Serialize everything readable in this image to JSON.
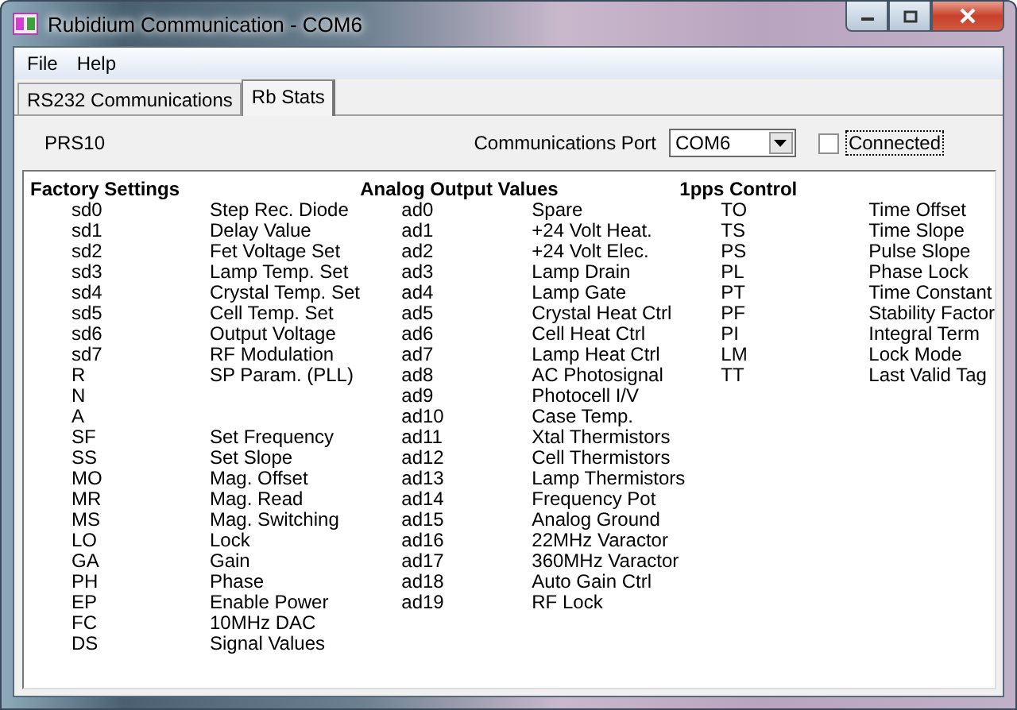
{
  "window": {
    "title": "Rubidium Communication - COM6"
  },
  "menu": [
    "File",
    "Help"
  ],
  "tabs": [
    {
      "label": "RS232 Communications",
      "selected": false
    },
    {
      "label": "Rb Stats",
      "selected": true
    }
  ],
  "device": "PRS10",
  "port": {
    "label": "Communications Port",
    "value": "COM6"
  },
  "connected": {
    "label": "Connected",
    "checked": false
  },
  "sections": [
    {
      "title": "Factory Settings",
      "rows": [
        {
          "code": "sd0",
          "name": "Step Rec. Diode"
        },
        {
          "code": "sd1",
          "name": "Delay Value"
        },
        {
          "code": "sd2",
          "name": "Fet Voltage Set"
        },
        {
          "code": "sd3",
          "name": "Lamp Temp. Set"
        },
        {
          "code": "sd4",
          "name": "Crystal Temp. Set"
        },
        {
          "code": "sd5",
          "name": "Cell Temp. Set"
        },
        {
          "code": "sd6",
          "name": "Output Voltage"
        },
        {
          "code": "sd7",
          "name": "RF Modulation"
        },
        {
          "code": "R",
          "name": "SP Param. (PLL)"
        },
        {
          "code": "N"
        },
        {
          "code": "A"
        },
        {
          "code": "SF",
          "name": "Set Frequency"
        },
        {
          "code": "SS",
          "name": "Set Slope"
        },
        {
          "code": "MO",
          "name": "Mag. Offset"
        },
        {
          "code": "MR",
          "name": "Mag. Read"
        },
        {
          "code": "MS",
          "name": "Mag. Switching"
        },
        {
          "code": "LO",
          "name": "Lock"
        },
        {
          "code": "GA",
          "name": "Gain"
        },
        {
          "code": "PH",
          "name": "Phase"
        },
        {
          "code": "EP",
          "name": "Enable Power"
        },
        {
          "code": "FC",
          "name": "10MHz DAC"
        },
        {
          "code": "DS",
          "name": "Signal Values"
        }
      ]
    },
    {
      "title": "Analog Output Values",
      "rows": [
        {
          "code": "ad0",
          "name": "Spare"
        },
        {
          "code": "ad1",
          "name": "+24 Volt Heat."
        },
        {
          "code": "ad2",
          "name": "+24 Volt Elec."
        },
        {
          "code": "ad3",
          "name": "Lamp Drain"
        },
        {
          "code": "ad4",
          "name": "Lamp Gate"
        },
        {
          "code": "ad5",
          "name": "Crystal Heat Ctrl"
        },
        {
          "code": "ad6",
          "name": "Cell Heat Ctrl"
        },
        {
          "code": "ad7",
          "name": "Lamp Heat Ctrl"
        },
        {
          "code": "ad8",
          "name": "AC Photosignal"
        },
        {
          "code": "ad9",
          "name": "Photocell I/V"
        },
        {
          "code": "ad10",
          "name": "Case Temp."
        },
        {
          "code": "ad11",
          "name": "Xtal Thermistors"
        },
        {
          "code": "ad12",
          "name": "Cell Thermistors"
        },
        {
          "code": "ad13",
          "name": "Lamp Thermistors"
        },
        {
          "code": "ad14",
          "name": "Frequency Pot"
        },
        {
          "code": "ad15",
          "name": "Analog Ground"
        },
        {
          "code": "ad16",
          "name": "22MHz Varactor"
        },
        {
          "code": "ad17",
          "name": "360MHz Varactor"
        },
        {
          "code": "ad18",
          "name": "Auto Gain Ctrl"
        },
        {
          "code": "ad19",
          "name": "RF Lock"
        }
      ]
    },
    {
      "title": "1pps Control",
      "rows": [
        {
          "code": "TO",
          "name": "Time Offset"
        },
        {
          "code": "TS",
          "name": "Time Slope"
        },
        {
          "code": "PS",
          "name": "Pulse Slope"
        },
        {
          "code": "PL",
          "name": "Phase Lock"
        },
        {
          "code": "PT",
          "name": "Time Constant"
        },
        {
          "code": "PF",
          "name": "Stability Factor"
        },
        {
          "code": "PI",
          "name": "Integral Term"
        },
        {
          "code": "LM",
          "name": "Lock Mode"
        },
        {
          "code": "TT",
          "name": "Last Valid Tag"
        }
      ]
    }
  ]
}
